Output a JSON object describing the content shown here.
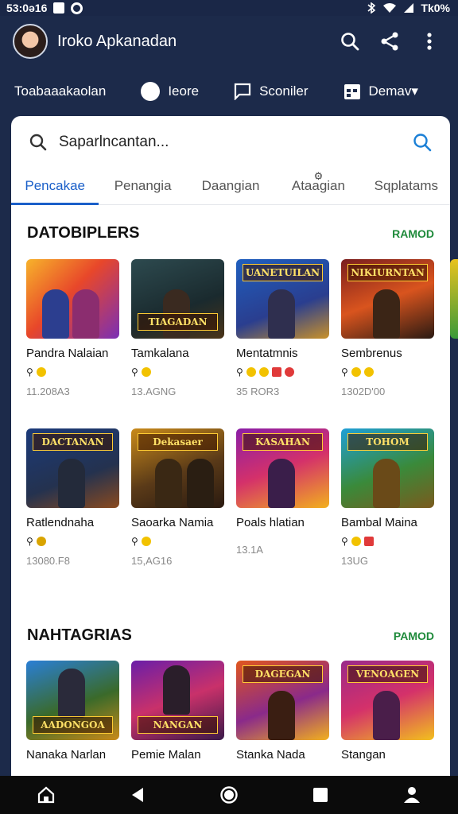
{
  "status_bar": {
    "time": "53:0ə16",
    "battery": "Tk0%"
  },
  "app_bar": {
    "title": "Iroko Apkanadan"
  },
  "top_nav": [
    {
      "label": "Toabaaakaolan",
      "icon": "none"
    },
    {
      "label": "Ieore",
      "icon": "dot"
    },
    {
      "label": "Sconiler",
      "icon": "chat-icon"
    },
    {
      "label": "Demav▾",
      "icon": "calendar-icon"
    }
  ],
  "search": {
    "placeholder": "Saparlncantan..."
  },
  "tabs": [
    {
      "label": "Pencakae"
    },
    {
      "label": "Penangia"
    },
    {
      "label": "Daangian"
    },
    {
      "label": "Ataagian"
    },
    {
      "label": "Sqplatams"
    }
  ],
  "sections": {
    "first": {
      "title": "DATOBIPLERS",
      "more": "RAMOD"
    },
    "second": {
      "title": "NAHTAGRIAS",
      "more": "PAMOD"
    }
  },
  "row1": [
    {
      "name": "Pandra Nalaian",
      "banner": "",
      "size": "11.208A3",
      "badges": [
        "⚲",
        "●"
      ]
    },
    {
      "name": "Tamkalana",
      "banner": "TIAGADAN",
      "size": "13.AGNG",
      "badges": [
        "⚲",
        "●"
      ]
    },
    {
      "name": "Mentatmnis",
      "banner": "UANETUILAN",
      "size": "35 ROR3",
      "badges": [
        "⚲",
        "●",
        "●",
        "■",
        "●"
      ]
    },
    {
      "name": "Sembrenus",
      "banner": "NIKIURNTAN",
      "size": "1302D'00",
      "badges": [
        "⚲",
        "●",
        "●"
      ]
    }
  ],
  "row2": [
    {
      "name": "Ratlendnaha",
      "banner": "DACTANAN",
      "size": "13080.F8",
      "badges": [
        "⚲",
        "●"
      ]
    },
    {
      "name": "Saoarka Namia",
      "banner": "Dekasaer",
      "size": "15,AG16",
      "badges": [
        "⚲",
        "●"
      ]
    },
    {
      "name": "Poals hlatian",
      "banner": "KASAHAN",
      "size": "13.1A",
      "badges": []
    },
    {
      "name": "Bambal Maina",
      "banner": "TOHOM",
      "size": "13UG",
      "badges": [
        "⚲",
        "●",
        "■"
      ]
    }
  ],
  "row3": [
    {
      "name": "Nanaka Narlan",
      "banner": "AADONGOA"
    },
    {
      "name": "Pemie Malan",
      "banner": "NANGAN"
    },
    {
      "name": "Stanka Nada",
      "banner": "DAGEGAN"
    },
    {
      "name": "Stangan",
      "banner": "VENOAGEN"
    }
  ],
  "colors": {
    "header_bg": "#1c2a4a",
    "accent": "#1a5fc9",
    "more_link": "#1e8a3a"
  }
}
